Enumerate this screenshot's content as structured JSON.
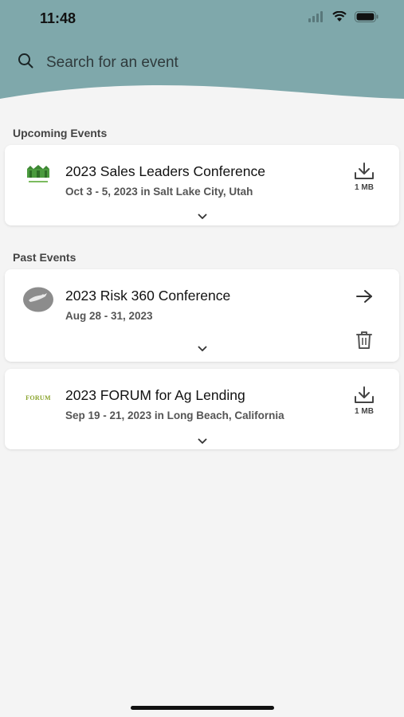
{
  "status": {
    "time": "11:48"
  },
  "search": {
    "placeholder": "Search for an event"
  },
  "sections": {
    "upcoming": "Upcoming Events",
    "past": "Past Events"
  },
  "events": [
    {
      "title": "2023 Sales Leaders Conference",
      "subtitle": "Oct 3 - 5, 2023 in Salt Lake City, Utah",
      "action": "download-icon",
      "size": "1 MB"
    },
    {
      "title": "2023 Risk 360 Conference",
      "subtitle": "Aug 28 - 31, 2023",
      "action": "arrow-right-icon",
      "secondary_action": "trash-icon"
    },
    {
      "title": "2023 FORUM for Ag Lending",
      "subtitle": "Sep 19 - 21, 2023 in Long Beach, California",
      "action": "download-icon",
      "size": "1 MB",
      "logo_text": "FORUM"
    }
  ],
  "colors": {
    "header": "#7fa8ab",
    "background": "#f4f4f4",
    "card": "#ffffff"
  }
}
